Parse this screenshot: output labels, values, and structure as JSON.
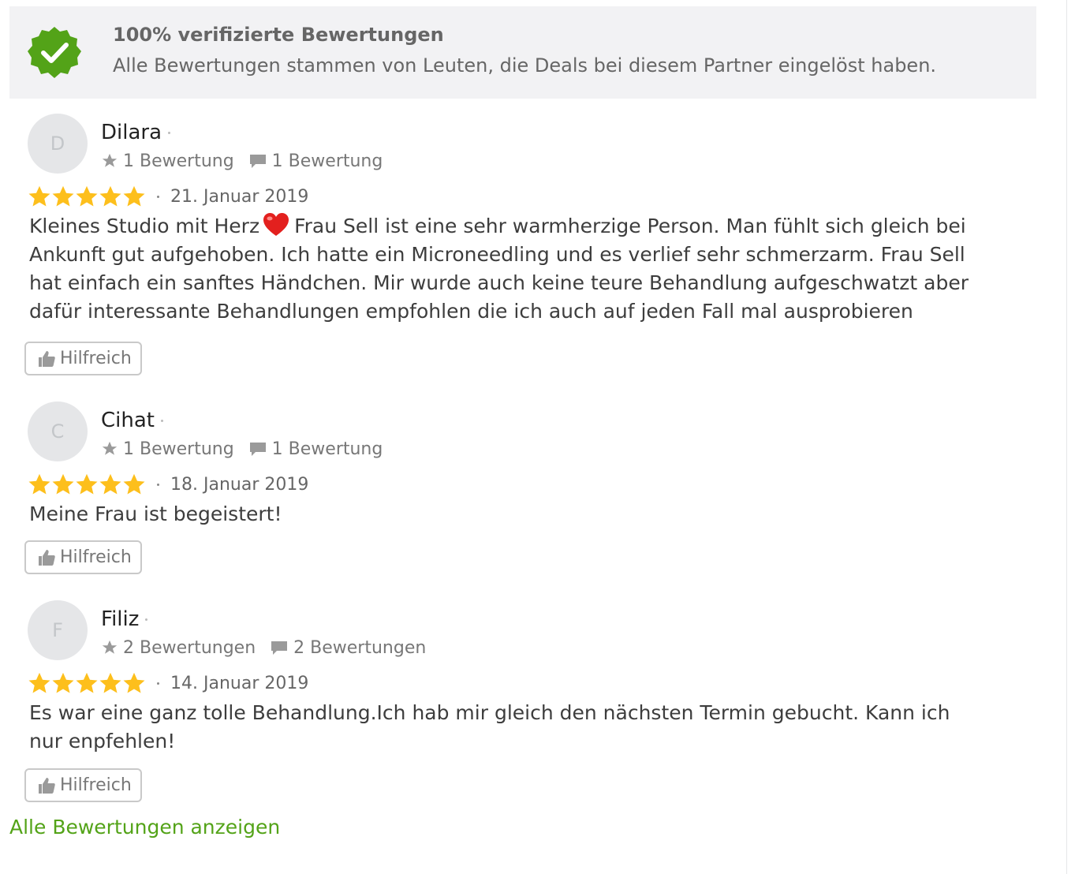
{
  "banner": {
    "title": "100% verifizierte Bewertungen",
    "text": "Alle Bewertungen stammen von Leuten, die Deals bei diesem Partner eingelöst haben.",
    "icon": "verified-check-badge-icon",
    "badge_color": "#53a318"
  },
  "reviews": [
    {
      "initial": "D",
      "name": "Dilara",
      "ratings_count": "1 Bewertung",
      "reviews_count": "1 Bewertung",
      "stars": 5,
      "date": "21. Januar 2019",
      "text_before_emoji": "Kleines Studio mit Herz",
      "emoji": "heart-emoji",
      "text_after_emoji": "Frau Sell ist eine sehr warmherzige Person. Man fühlt sich gleich bei Ankunft gut aufgehoben. Ich hatte ein Microneedling und es verlief sehr schmerzarm. Frau Sell hat einfach ein sanftes Händchen. Mir wurde auch keine teure Behandlung aufgeschwatzt aber dafür interessante Behandlungen empfohlen die ich auch auf jeden Fall mal ausprobieren",
      "helpful_label": "Hilfreich"
    },
    {
      "initial": "C",
      "name": "Cihat",
      "ratings_count": "1 Bewertung",
      "reviews_count": "1 Bewertung",
      "stars": 5,
      "date": "18. Januar 2019",
      "text": "Meine Frau ist begeistert!",
      "helpful_label": "Hilfreich"
    },
    {
      "initial": "F",
      "name": "Filiz",
      "ratings_count": "2 Bewertungen",
      "reviews_count": "2 Bewertungen",
      "stars": 5,
      "date": "14. Januar 2019",
      "text": "Es war eine ganz tolle Behandlung.Ich hab mir gleich den nächsten Termin gebucht. Kann ich nur enpfehlen!",
      "helpful_label": "Hilfreich"
    }
  ],
  "footer": {
    "all_reviews_link": "Alle Bewertungen anzeigen"
  },
  "colors": {
    "star": "#fdbf1c",
    "link": "#53a318",
    "banner_bg": "#f2f2f4"
  }
}
